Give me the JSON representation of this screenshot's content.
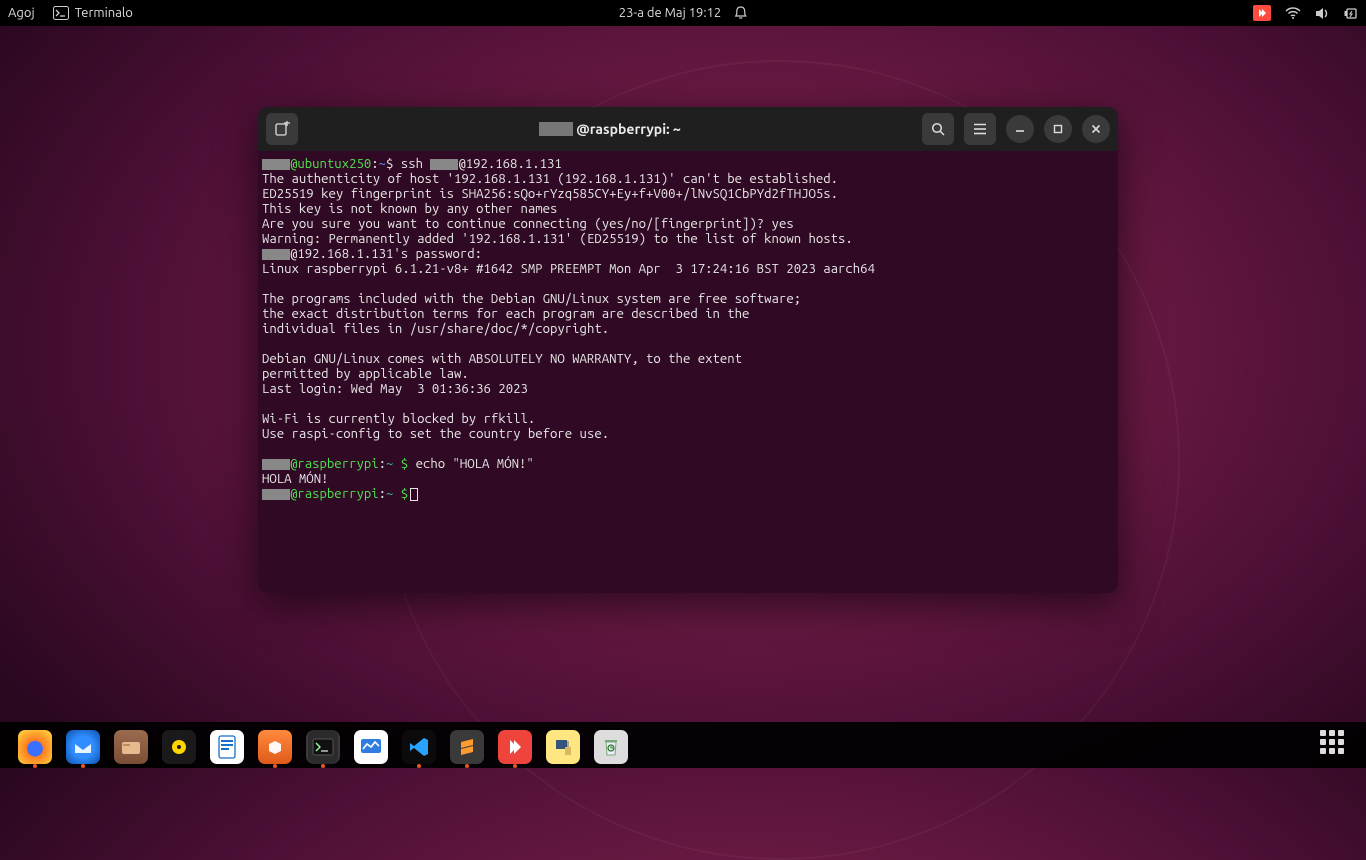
{
  "topbar": {
    "activities": "Agoj",
    "app_name": "Terminalo",
    "datetime": "23-a de Maj  19:12"
  },
  "window": {
    "title_suffix": "@raspberrypi: ~"
  },
  "terminal": {
    "prompt1_userhost": "@ubuntux250",
    "prompt1_sep": ":",
    "prompt1_path": "~",
    "prompt1_dollar": "$",
    "cmd1": " ssh ",
    "cmd1_tail": "@192.168.1.131",
    "line2": "The authenticity of host '192.168.1.131 (192.168.1.131)' can't be established.",
    "line3": "ED25519 key fingerprint is SHA256:sQo+rYzq585CY+Ey+f+V00+/lNvSQ1CbPYd2fTHJO5s.",
    "line4": "This key is not known by any other names",
    "line5": "Are you sure you want to continue connecting (yes/no/[fingerprint])? yes",
    "line6": "Warning: Permanently added '192.168.1.131' (ED25519) to the list of known hosts.",
    "line7": "@192.168.1.131's password:",
    "line8": "Linux raspberrypi 6.1.21-v8+ #1642 SMP PREEMPT Mon Apr  3 17:24:16 BST 2023 aarch64",
    "blank": "",
    "line10": "The programs included with the Debian GNU/Linux system are free software;",
    "line11": "the exact distribution terms for each program are described in the",
    "line12": "individual files in /usr/share/doc/*/copyright.",
    "line14": "Debian GNU/Linux comes with ABSOLUTELY NO WARRANTY, to the extent",
    "line15": "permitted by applicable law.",
    "line16": "Last login: Wed May  3 01:36:36 2023",
    "line18": "Wi-Fi is currently blocked by rfkill.",
    "line19": "Use raspi-config to set the country before use.",
    "prompt2_userhost": "@raspberrypi",
    "prompt2_sep": ":",
    "prompt2_path": "~ ",
    "prompt2_dollar": "$",
    "cmd2": " echo \"HOLA MÓN!\"",
    "out2": "HOLA MÓN!",
    "prompt3_userhost": "@raspberrypi",
    "prompt3_sep": ":",
    "prompt3_path": "~ ",
    "prompt3_dollar": "$"
  },
  "dock": {
    "items": [
      {
        "name": "firefox",
        "indicator": true
      },
      {
        "name": "thunderbird",
        "indicator": true
      },
      {
        "name": "files",
        "indicator": false
      },
      {
        "name": "rhythmbox",
        "indicator": false
      },
      {
        "name": "writer",
        "indicator": false
      },
      {
        "name": "software",
        "indicator": true
      },
      {
        "name": "terminal",
        "indicator": true,
        "running": true
      },
      {
        "name": "monitor",
        "indicator": false
      },
      {
        "name": "vscode",
        "indicator": true
      },
      {
        "name": "sublime",
        "indicator": true
      },
      {
        "name": "anydesk",
        "indicator": true
      },
      {
        "name": "putty",
        "indicator": false
      },
      {
        "name": "trash",
        "indicator": false
      }
    ]
  }
}
